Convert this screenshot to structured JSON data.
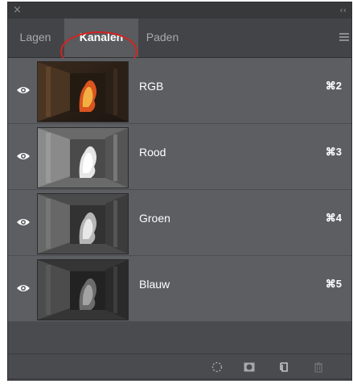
{
  "titlebar": {
    "close_glyph": "×",
    "collapse_glyph": "‹‹"
  },
  "tabs": [
    {
      "label": "Lagen",
      "active": false
    },
    {
      "label": "Kanalen",
      "active": true
    },
    {
      "label": "Paden",
      "active": false
    }
  ],
  "channels": [
    {
      "name": "RGB",
      "shortcut": "⌘2",
      "visible": true
    },
    {
      "name": "Rood",
      "shortcut": "⌘3",
      "visible": true
    },
    {
      "name": "Groen",
      "shortcut": "⌘4",
      "visible": true
    },
    {
      "name": "Blauw",
      "shortcut": "⌘5",
      "visible": true
    }
  ],
  "footer_icons": [
    "load-selection-icon",
    "save-mask-icon",
    "new-channel-icon",
    "trash-icon"
  ],
  "colors": {
    "panel_bg": "#4a4b4e",
    "row_bg": "#5d5e62",
    "highlight": "#d62121"
  }
}
